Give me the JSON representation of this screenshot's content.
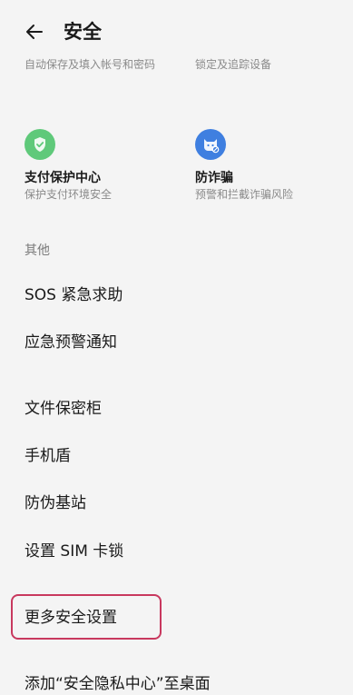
{
  "header": {
    "title": "安全"
  },
  "previous_tiles": {
    "left_desc": "自动保存及填入帐号和密码",
    "right_desc": "锁定及追踪设备"
  },
  "tiles": [
    {
      "title": "支付保护中心",
      "subtitle": "保护支付环境安全",
      "icon": "shield-check-icon",
      "color": "#5fc97a"
    },
    {
      "title": "防诈骗",
      "subtitle": "预警和拦截诈骗风险",
      "icon": "anti-fraud-icon",
      "color": "#3f7fe0"
    }
  ],
  "other_section": {
    "label": "其他",
    "items": [
      "SOS 紧急求助",
      "应急预警通知",
      "文件保密柜",
      "手机盾",
      "防伪基站",
      "设置 SIM 卡锁",
      "更多安全设置",
      "添加“安全隐私中心”至桌面"
    ]
  },
  "colors": {
    "highlight": "#c8385e",
    "background": "#f4f4f4"
  }
}
